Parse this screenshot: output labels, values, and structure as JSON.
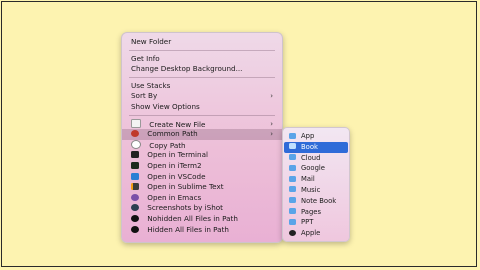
{
  "context_menu": {
    "group1": [
      {
        "label": "New Folder"
      }
    ],
    "group2": [
      {
        "label": "Get Info"
      },
      {
        "label": "Change Desktop Background..."
      }
    ],
    "group3": [
      {
        "label": "Use Stacks"
      },
      {
        "label": "Sort By",
        "submenu": true
      },
      {
        "label": "Show View Options"
      }
    ],
    "group4": [
      {
        "label": "Create New File",
        "icon": "new-file-icon",
        "submenu": true
      },
      {
        "label": "Common Path",
        "icon": "common-path-icon",
        "submenu": true,
        "highlighted": true
      },
      {
        "label": "Copy Path",
        "icon": "copy-path-icon"
      },
      {
        "label": "Open in Terminal",
        "icon": "terminal-icon"
      },
      {
        "label": "Open in iTerm2",
        "icon": "iterm2-icon"
      },
      {
        "label": "Open in VSCode",
        "icon": "vscode-icon"
      },
      {
        "label": "Open in Sublime Text",
        "icon": "sublime-text-icon"
      },
      {
        "label": "Open in Emacs",
        "icon": "emacs-icon"
      },
      {
        "label": "Screenshots by iShot",
        "icon": "ishot-icon"
      },
      {
        "label": "Nohidden All Files in Path",
        "icon": "eye-icon"
      },
      {
        "label": "Hidden All Files in Path",
        "icon": "eye-off-icon"
      }
    ],
    "chevron": "›"
  },
  "common_path_submenu": {
    "items": [
      {
        "label": "App"
      },
      {
        "label": "Book",
        "selected": true
      },
      {
        "label": "Cloud"
      },
      {
        "label": "Google"
      },
      {
        "label": "Mail"
      },
      {
        "label": "Music"
      },
      {
        "label": "Note Book"
      },
      {
        "label": "Pages"
      },
      {
        "label": "PPT"
      },
      {
        "label": "Apple"
      }
    ]
  },
  "colors": {
    "background": "#fdf3b0",
    "selection": "#2f6bd8"
  }
}
